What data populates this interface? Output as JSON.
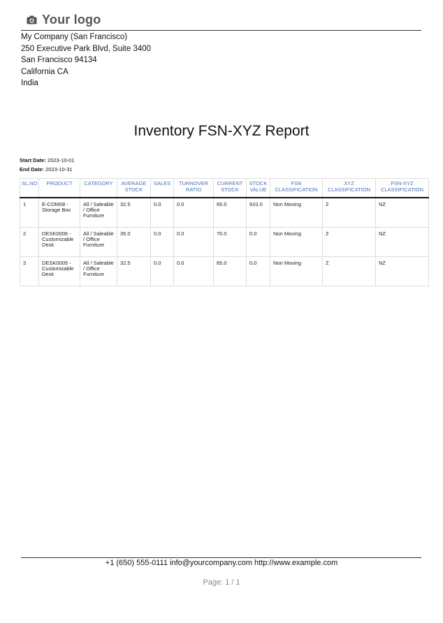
{
  "logo": {
    "text": "Your logo",
    "icon": "camera-icon"
  },
  "company": {
    "lines": [
      "My Company (San Francisco)",
      "250 Executive Park Blvd, Suite 3400",
      "San Francisco 94134",
      "California CA",
      "India"
    ]
  },
  "report": {
    "title": "Inventory FSN-XYZ Report",
    "start_label": "Start Date:",
    "start_value": "2023-10-01",
    "end_label": "End Date:",
    "end_value": "2023-10-31"
  },
  "table": {
    "headers": [
      "Sl.no",
      "PRODUCT",
      "CATEGORY",
      "AVERAGE STOCK",
      "SALES",
      "TURNOVER RATIO",
      "CURRENT STOCK",
      "STOCK VALUE",
      "FSN CLASSIFICATION",
      "XYZ CLASSIFICATION",
      "FSN-XYZ CLASSIFICATION"
    ],
    "rows": [
      [
        "1",
        "E-COM08 - Storage Box",
        "All / Saleable / Office Furniture",
        "32.5",
        "0.0",
        "0.0",
        "65.0",
        "910.0",
        "Non Moving",
        "Z",
        "NZ"
      ],
      [
        "2",
        "DESK0006 - Customizable Desk",
        "All / Saleable / Office Furniture",
        "35.0",
        "0.0",
        "0.0",
        "70.0",
        "0.0",
        "Non Moving",
        "Z",
        "NZ"
      ],
      [
        "3",
        "DESK0005 - Customizable Desk",
        "All / Saleable / Office Furniture",
        "32.5",
        "0.0",
        "0.0",
        "65.0",
        "0.0",
        "Non Moving",
        "Z",
        "NZ"
      ]
    ]
  },
  "footer": {
    "contact": "+1 (650) 555-0111 info@yourcompany.com http://www.example.com",
    "page": "Page: 1 / 1"
  }
}
